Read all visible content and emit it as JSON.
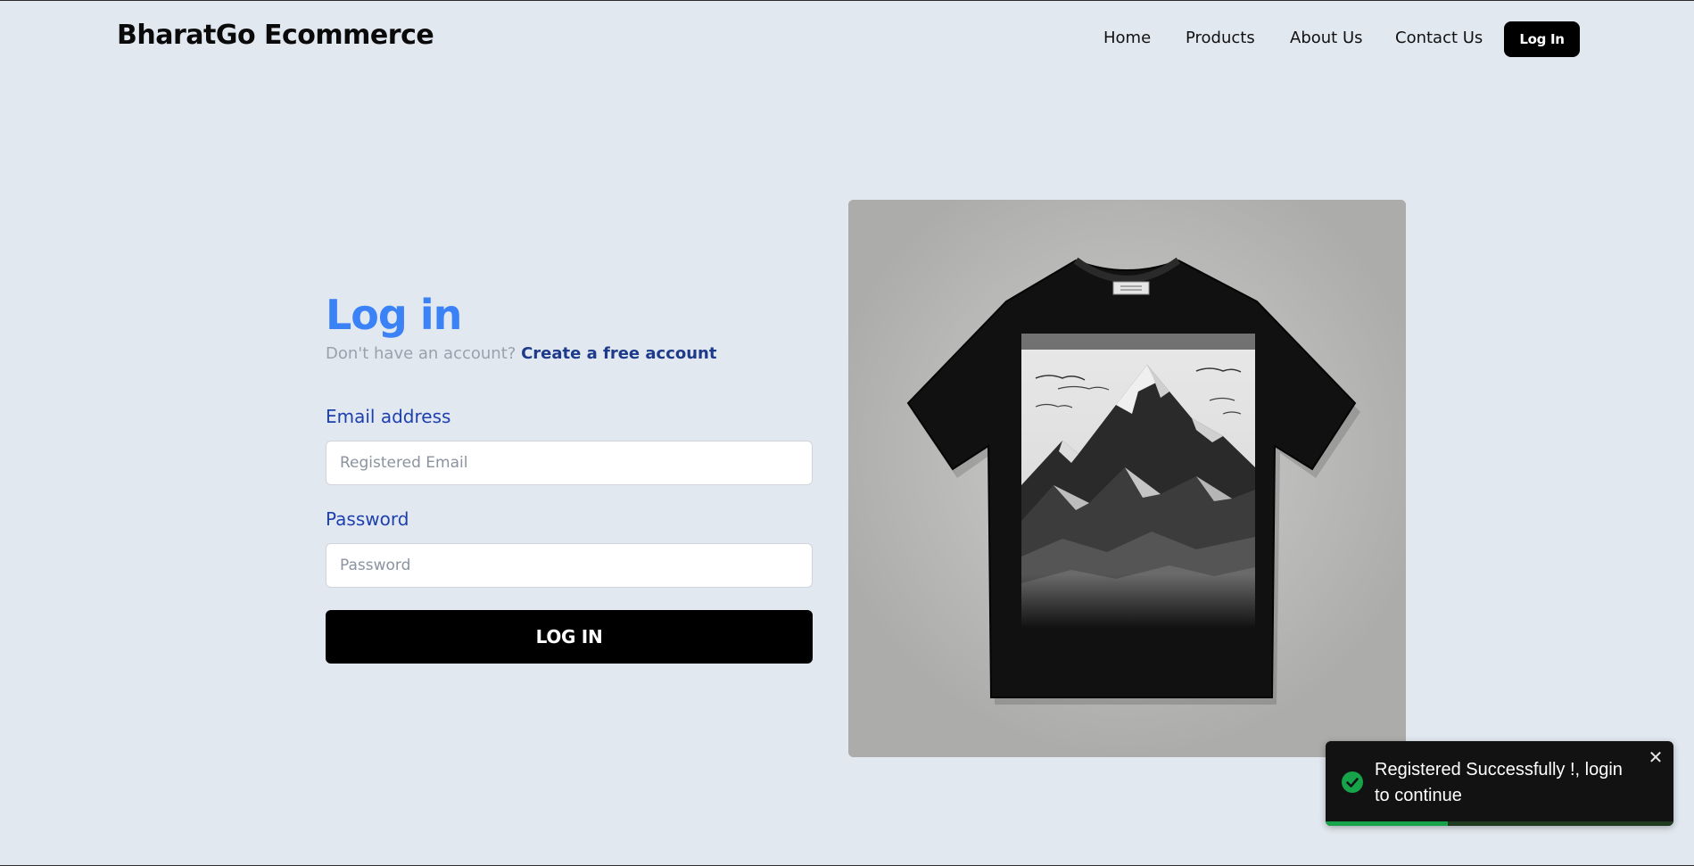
{
  "header": {
    "brand": "BharatGo Ecommerce",
    "nav": [
      {
        "label": "Home"
      },
      {
        "label": "Products"
      },
      {
        "label": "About Us"
      },
      {
        "label": "Contact Us"
      }
    ],
    "login_label": "Log In"
  },
  "login_form": {
    "title": "Log in",
    "subtitle_prefix": "Don't have an account?",
    "create_account_link": "Create a free account",
    "email_label": "Email address",
    "email_placeholder": "Registered Email",
    "email_value": "",
    "password_label": "Password",
    "password_placeholder": "Password",
    "password_value": "",
    "submit_label": "LOG IN"
  },
  "hero": {
    "image": "black-tshirt-mountain-print"
  },
  "toast": {
    "message": "Registered Successfully !, login to continue",
    "icon": "check-circle-icon",
    "close_icon": "close-icon",
    "progress_fraction": 0.35
  },
  "colors": {
    "background": "#e2e8f0",
    "title_accent": "#3b82f6",
    "label_color": "#1e40af",
    "link_color": "#1e3a8a",
    "button_bg": "#000000",
    "toast_bg": "#121212",
    "toast_success": "#16a34a"
  }
}
